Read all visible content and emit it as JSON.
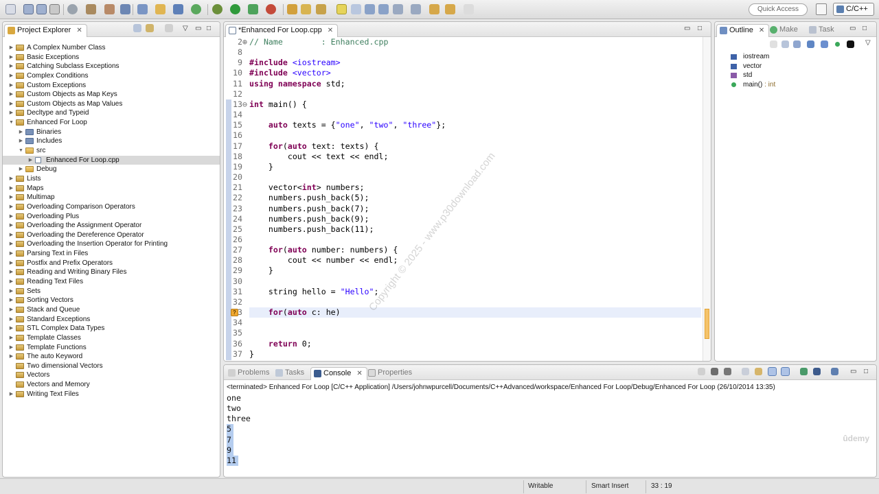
{
  "toolbar": {
    "quick_access_placeholder": "Quick Access",
    "perspective_label": "C/C++"
  },
  "project_explorer": {
    "title": "Project Explorer",
    "close_glyph": "✕",
    "items": [
      {
        "label": "A Complex Number Class",
        "depth": 0,
        "expanded": false,
        "type": "project"
      },
      {
        "label": "Basic Exceptions",
        "depth": 0,
        "expanded": false,
        "type": "project"
      },
      {
        "label": "Catching Subclass Exceptions",
        "depth": 0,
        "expanded": false,
        "type": "project"
      },
      {
        "label": "Complex Conditions",
        "depth": 0,
        "expanded": false,
        "type": "project"
      },
      {
        "label": "Custom Exceptions",
        "depth": 0,
        "expanded": false,
        "type": "project"
      },
      {
        "label": "Custom Objects as Map Keys",
        "depth": 0,
        "expanded": false,
        "type": "project"
      },
      {
        "label": "Custom Objects as Map Values",
        "depth": 0,
        "expanded": false,
        "type": "project"
      },
      {
        "label": "Decltype and Typeid",
        "depth": 0,
        "expanded": false,
        "type": "project"
      },
      {
        "label": "Enhanced For Loop",
        "depth": 0,
        "expanded": true,
        "type": "project"
      },
      {
        "label": "Binaries",
        "depth": 1,
        "expanded": false,
        "type": "bin"
      },
      {
        "label": "Includes",
        "depth": 1,
        "expanded": false,
        "type": "bin"
      },
      {
        "label": "src",
        "depth": 1,
        "expanded": true,
        "type": "folder"
      },
      {
        "label": "Enhanced For Loop.cpp",
        "depth": 2,
        "expanded": false,
        "type": "file",
        "selected": true
      },
      {
        "label": "Debug",
        "depth": 1,
        "expanded": false,
        "type": "folder"
      },
      {
        "label": "Lists",
        "depth": 0,
        "expanded": false,
        "type": "project"
      },
      {
        "label": "Maps",
        "depth": 0,
        "expanded": false,
        "type": "project"
      },
      {
        "label": "Multimap",
        "depth": 0,
        "expanded": false,
        "type": "project"
      },
      {
        "label": "Overloading Comparison Operators",
        "depth": 0,
        "expanded": false,
        "type": "project"
      },
      {
        "label": "Overloading Plus",
        "depth": 0,
        "expanded": false,
        "type": "project"
      },
      {
        "label": "Overloading the Assignment Operator",
        "depth": 0,
        "expanded": false,
        "type": "project"
      },
      {
        "label": "Overloading the Dereference Operator",
        "depth": 0,
        "expanded": false,
        "type": "project"
      },
      {
        "label": "Overloading the Insertion Operator for Printing",
        "depth": 0,
        "expanded": false,
        "type": "project"
      },
      {
        "label": "Parsing Text in Files",
        "depth": 0,
        "expanded": false,
        "type": "project"
      },
      {
        "label": "Postfix and Prefix Operators",
        "depth": 0,
        "expanded": false,
        "type": "project"
      },
      {
        "label": "Reading and Writing Binary Files",
        "depth": 0,
        "expanded": false,
        "type": "project"
      },
      {
        "label": "Reading Text Files",
        "depth": 0,
        "expanded": false,
        "type": "project"
      },
      {
        "label": "Sets",
        "depth": 0,
        "expanded": false,
        "type": "project"
      },
      {
        "label": "Sorting Vectors",
        "depth": 0,
        "expanded": false,
        "type": "project"
      },
      {
        "label": "Stack and Queue",
        "depth": 0,
        "expanded": false,
        "type": "project"
      },
      {
        "label": "Standard Exceptions",
        "depth": 0,
        "expanded": false,
        "type": "project"
      },
      {
        "label": "STL Complex Data Types",
        "depth": 0,
        "expanded": false,
        "type": "project"
      },
      {
        "label": "Template Classes",
        "depth": 0,
        "expanded": false,
        "type": "project"
      },
      {
        "label": "Template Functions",
        "depth": 0,
        "expanded": false,
        "type": "project"
      },
      {
        "label": "The auto Keyword",
        "depth": 0,
        "expanded": false,
        "type": "project"
      },
      {
        "label": "Two dimensional Vectors",
        "depth": 0,
        "expanded": null,
        "type": "project"
      },
      {
        "label": "Vectors",
        "depth": 0,
        "expanded": null,
        "type": "project"
      },
      {
        "label": "Vectors and Memory",
        "depth": 0,
        "expanded": null,
        "type": "project"
      },
      {
        "label": "Writing Text Files",
        "depth": 0,
        "expanded": false,
        "type": "project"
      }
    ]
  },
  "editor": {
    "tab_title": "*Enhanced For Loop.cpp",
    "close_glyph": "✕",
    "lines": [
      {
        "no": "2",
        "fold": "⊕",
        "html": "<span class=\"cm\">// Name        : Enhanced.cpp</span>"
      },
      {
        "no": "8",
        "html": ""
      },
      {
        "no": "9",
        "html": "<span class=\"kw\">#include</span> <span class=\"inc\">&lt;iostream&gt;</span>"
      },
      {
        "no": "10",
        "html": "<span class=\"kw\">#include</span> <span class=\"inc\">&lt;vector&gt;</span>"
      },
      {
        "no": "11",
        "html": "<span class=\"kw\">using namespace</span> std;"
      },
      {
        "no": "12",
        "html": ""
      },
      {
        "no": "13",
        "fold": "⊖",
        "html": "<span class=\"kw\">int</span> main() {"
      },
      {
        "no": "14",
        "html": ""
      },
      {
        "no": "15",
        "html": "    <span class=\"kw\">auto</span> texts = {<span class=\"str\">\"one\"</span>, <span class=\"str\">\"two\"</span>, <span class=\"str\">\"three\"</span>};"
      },
      {
        "no": "16",
        "html": ""
      },
      {
        "no": "17",
        "html": "    <span class=\"kw\">for</span>(<span class=\"kw\">auto</span> text: texts) {"
      },
      {
        "no": "18",
        "html": "        cout &lt;&lt; text &lt;&lt; endl;"
      },
      {
        "no": "19",
        "html": "    }"
      },
      {
        "no": "20",
        "html": ""
      },
      {
        "no": "21",
        "html": "    vector&lt;<span class=\"kw\">int</span>&gt; numbers;"
      },
      {
        "no": "22",
        "html": "    numbers.push_back(5);"
      },
      {
        "no": "23",
        "html": "    numbers.push_back(7);"
      },
      {
        "no": "24",
        "html": "    numbers.push_back(9);"
      },
      {
        "no": "25",
        "html": "    numbers.push_back(11);"
      },
      {
        "no": "26",
        "html": ""
      },
      {
        "no": "27",
        "html": "    <span class=\"kw\">for</span>(<span class=\"kw\">auto</span> number: numbers) {"
      },
      {
        "no": "28",
        "html": "        cout &lt;&lt; number &lt;&lt; endl;"
      },
      {
        "no": "29",
        "html": "    }"
      },
      {
        "no": "30",
        "html": ""
      },
      {
        "no": "31",
        "html": "    string hello = <span class=\"str\">\"Hello\"</span>;"
      },
      {
        "no": "32",
        "html": ""
      },
      {
        "no": "33",
        "current": true,
        "warn": "?",
        "html": "    <span class=\"kw\">for</span>(<span class=\"kw\">auto</span> c: he)"
      },
      {
        "no": "34",
        "html": ""
      },
      {
        "no": "35",
        "html": ""
      },
      {
        "no": "36",
        "html": "    <span class=\"kw\">return</span> 0;"
      },
      {
        "no": "37",
        "html": "}"
      }
    ],
    "watermark": "Copyright © 2025 - www.p30download.com"
  },
  "outline": {
    "tabs": [
      {
        "label": "Outline",
        "active": true,
        "close": "✕"
      },
      {
        "label": "Make",
        "active": false
      },
      {
        "label": "Task",
        "active": false
      }
    ],
    "items": [
      {
        "label": "iostream",
        "kind": "inc",
        "type": ""
      },
      {
        "label": "vector",
        "kind": "inc",
        "type": ""
      },
      {
        "label": "std",
        "kind": "ns",
        "type": ""
      },
      {
        "label": "main()",
        "kind": "fn",
        "type": " : int"
      }
    ]
  },
  "console": {
    "tabs": [
      {
        "label": "Problems",
        "active": false
      },
      {
        "label": "Tasks",
        "active": false
      },
      {
        "label": "Console",
        "active": true,
        "close": "✕"
      },
      {
        "label": "Properties",
        "active": false
      }
    ],
    "header": "<terminated> Enhanced For Loop [C/C++ Application] /Users/johnwpurcell/Documents/C++Advanced/workspace/Enhanced For Loop/Debug/Enhanced For Loop (26/10/2014 13:35)",
    "output": [
      {
        "text": "one",
        "selected": false
      },
      {
        "text": "two",
        "selected": false
      },
      {
        "text": "three",
        "selected": false
      },
      {
        "text": "5",
        "selected": true
      },
      {
        "text": "7",
        "selected": true
      },
      {
        "text": "9",
        "selected": true
      },
      {
        "text": "11",
        "selected": true
      }
    ],
    "watermark": "ûdemy"
  },
  "statusbar": {
    "writable": "Writable",
    "insert_mode": "Smart Insert",
    "position": "33 : 19"
  },
  "colors": {
    "keyword": "#7f0055",
    "string": "#2a00ff",
    "comment": "#3f7f5f",
    "selection": "#b5cdef",
    "current_line": "#e8eefb"
  }
}
